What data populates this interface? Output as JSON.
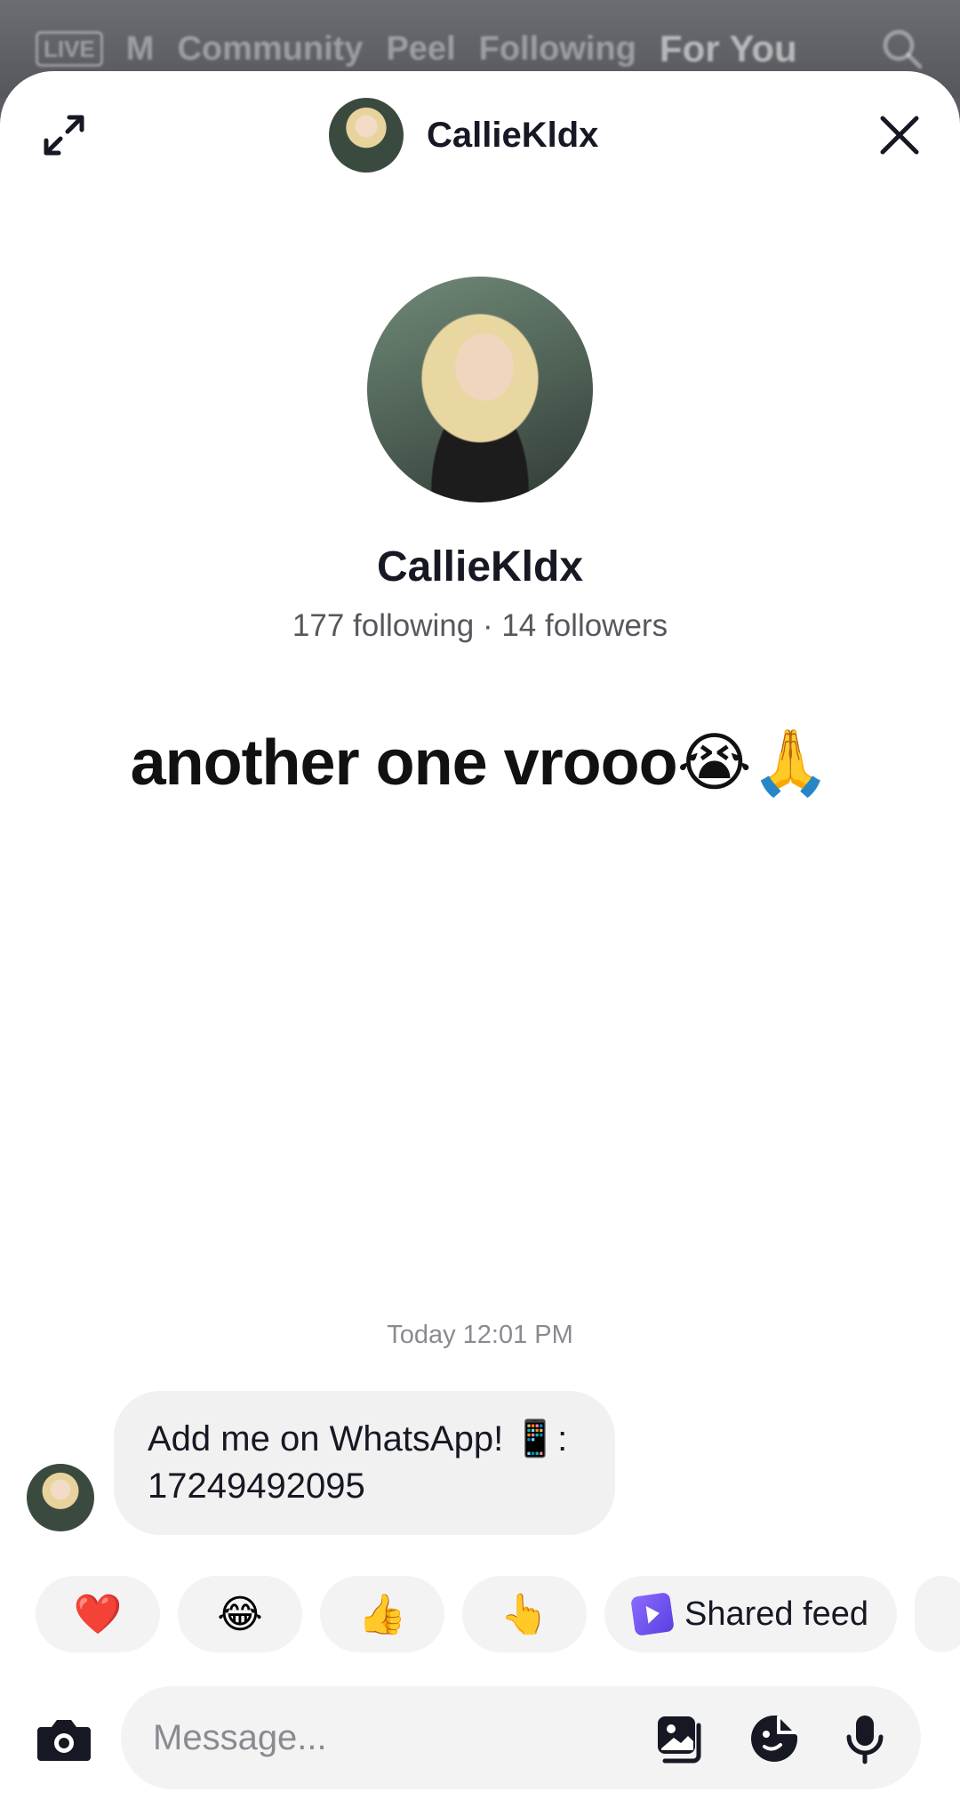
{
  "background_nav": {
    "live": "LIVE",
    "m": "M",
    "community": "Community",
    "peel": "Peel",
    "following": "Following",
    "for_you": "For You"
  },
  "header": {
    "username": "CallieKldx"
  },
  "profile": {
    "name": "CallieKldx",
    "stats": "177 following · 14 followers"
  },
  "caption": "another one vrooo😭🙏",
  "chat": {
    "timestamp": "Today 12:01 PM",
    "message_line1": "Add me on WhatsApp! 📱:",
    "message_line2": "17249492095"
  },
  "reactions": {
    "heart": "❤️",
    "laugh": "😂",
    "thumbs_up": "👍",
    "point": "👆",
    "shared_feed": "Shared feed"
  },
  "composer": {
    "placeholder": "Message..."
  },
  "icons": {
    "expand": "expand-icon",
    "close": "close-icon",
    "camera": "camera-icon",
    "gallery": "gallery-icon",
    "sticker": "sticker-icon",
    "mic": "microphone-icon",
    "search": "search-icon"
  },
  "colors": {
    "feed_accent": "#6b4ef5",
    "text_primary": "#161823"
  }
}
